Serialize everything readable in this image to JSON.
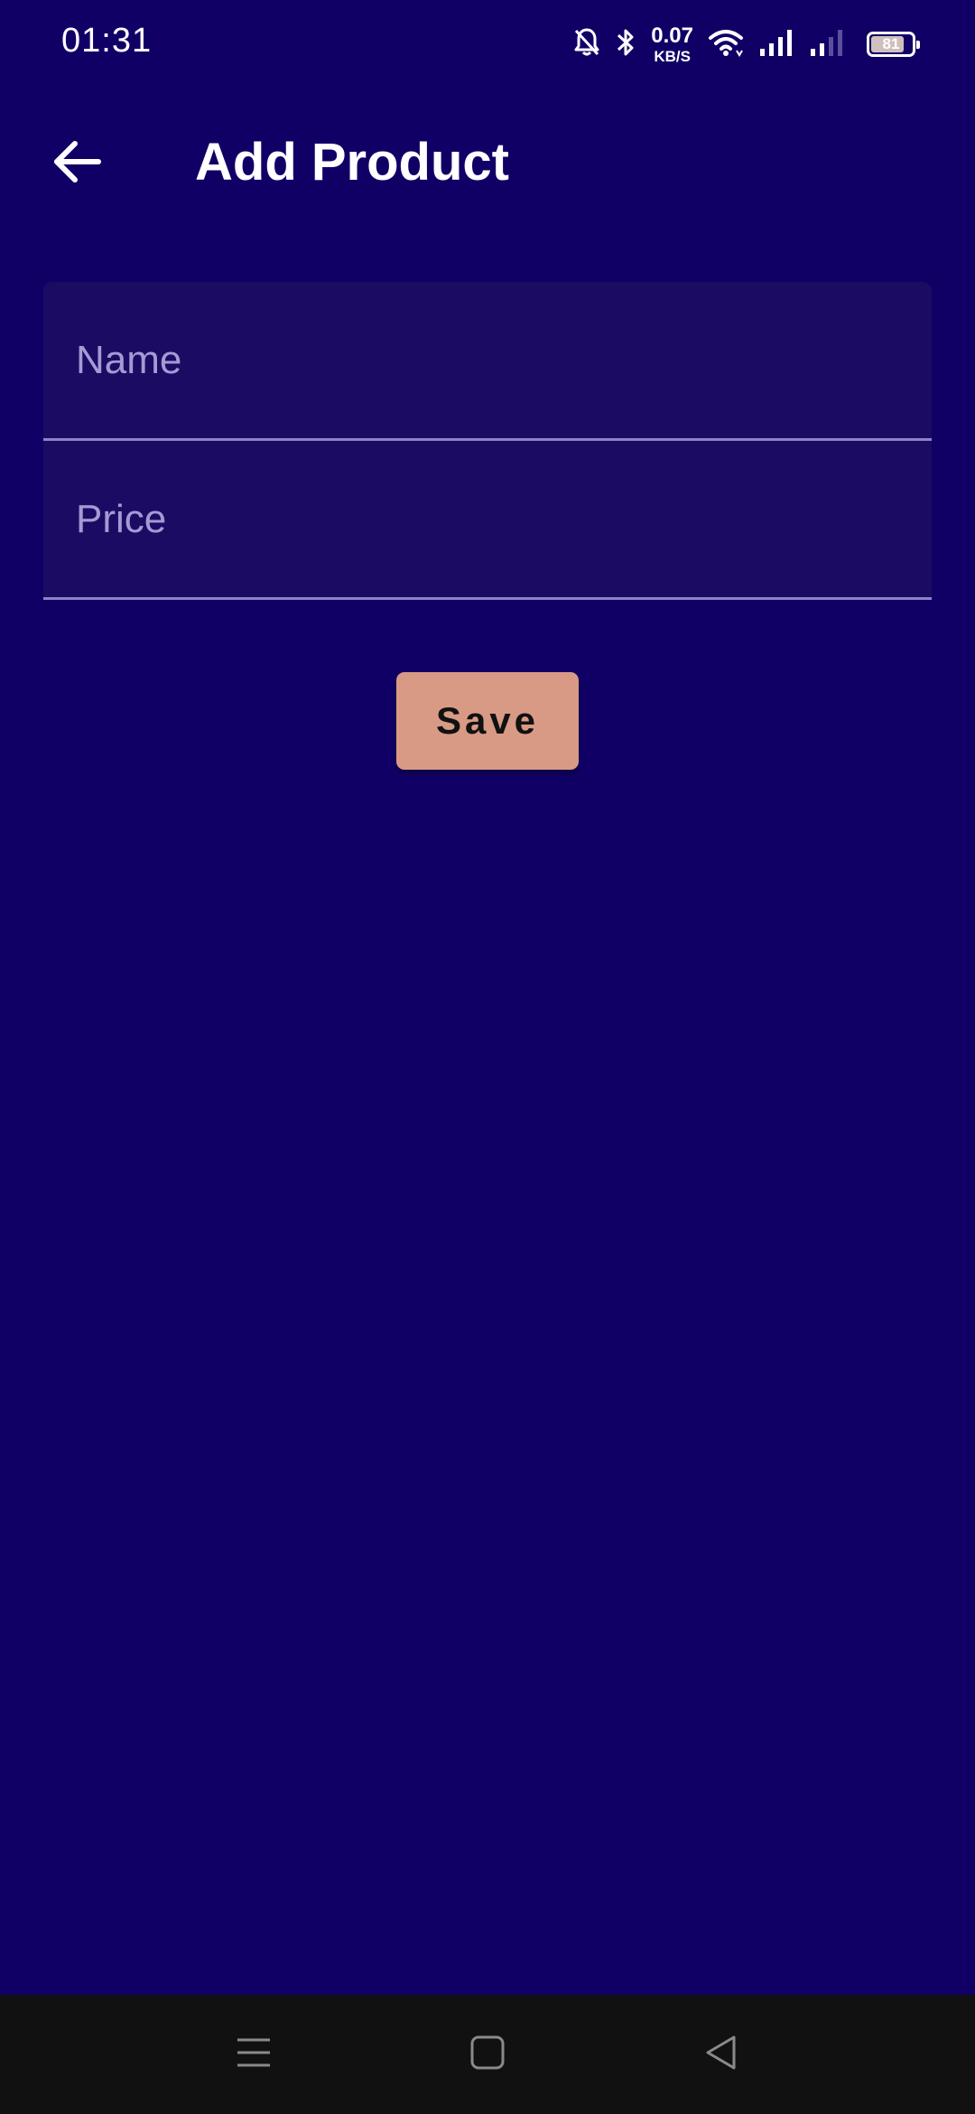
{
  "status_bar": {
    "time": "01:31",
    "net_speed_value": "0.07",
    "net_speed_unit": "KB/S",
    "battery_level": "81",
    "battery_fraction": 0.81,
    "icons": [
      "mute-bell-icon",
      "bluetooth-icon",
      "wifi-icon",
      "signal-icon",
      "signal-weak-icon",
      "battery-icon"
    ]
  },
  "app_bar": {
    "title": "Add Product",
    "back_icon": "arrow-back-icon"
  },
  "form": {
    "name_field": {
      "placeholder": "Name",
      "value": ""
    },
    "price_field": {
      "placeholder": "Price",
      "value": ""
    }
  },
  "actions": {
    "save_label": "Save"
  },
  "nav_bar": {
    "icons": [
      "menu-icon",
      "home-icon",
      "back-icon"
    ]
  },
  "colors": {
    "background": "#100066",
    "field_background": "#1c0b63",
    "field_underline": "#8e82c9",
    "placeholder": "#a59ad4",
    "save_button": "#d99a85",
    "nav_bar": "#111111"
  }
}
